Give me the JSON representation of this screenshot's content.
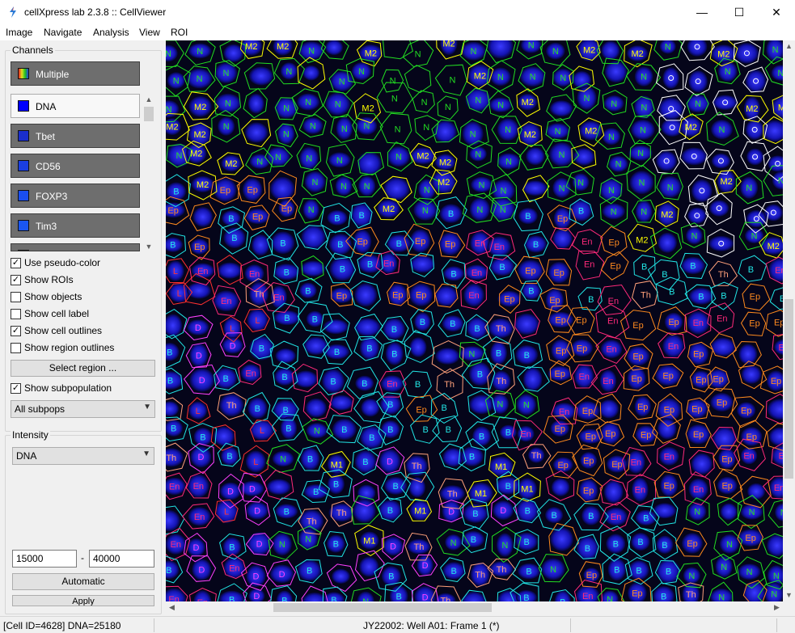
{
  "window": {
    "title": "cellXpress lab 2.3.8 :: CellViewer",
    "minimize": "—",
    "maximize": "☐",
    "close": "✕"
  },
  "menu": [
    "Image",
    "Navigate",
    "Analysis",
    "View",
    "ROI"
  ],
  "channels": {
    "label": "Channels",
    "items": [
      {
        "label": "Multiple",
        "color": "multi",
        "selected": false
      },
      {
        "label": "DNA",
        "color": "#0000ff",
        "selected": true
      },
      {
        "label": "Tbet",
        "color": "#0000ff",
        "selected": false
      },
      {
        "label": "CD56",
        "color": "#0000ff",
        "selected": false
      },
      {
        "label": "FOXP3",
        "color": "#0000ff",
        "selected": false
      },
      {
        "label": "Tim3",
        "color": "#0000ff",
        "selected": false
      }
    ]
  },
  "options": [
    {
      "label": "Use pseudo-color",
      "checked": true
    },
    {
      "label": "Show ROIs",
      "checked": true
    },
    {
      "label": "Show objects",
      "checked": false
    },
    {
      "label": "Show cell label",
      "checked": false
    },
    {
      "label": "Show cell outlines",
      "checked": true
    },
    {
      "label": "Show region outlines",
      "checked": false
    }
  ],
  "select_region_label": "Select region ...",
  "subpop": {
    "label": "Show subpopulation",
    "checked": true,
    "selected": "All subpops"
  },
  "intensity": {
    "label": "Intensity",
    "channel": "DNA",
    "min": "15000",
    "dash": "-",
    "max": "40000",
    "automatic_label": "Automatic",
    "apply_label": "Apply"
  },
  "status": {
    "cell": "[Cell ID=4628]  DNA=25180",
    "frame": "JY22002: Well A01: Frame 1 (*)"
  },
  "colors": {
    "N": "#22dd22",
    "M2": "#ffff00",
    "Ep": "#ff8a1e",
    "B": "#22e6e6",
    "En": "#ff2a7a",
    "Th": "#ffa07a",
    "L": "#ff3030",
    "D": "#ff40ff",
    "M1": "#ffff00",
    "Tc": "#ffa07a",
    "Tr": "#ffa07a",
    "O": "#ffffff"
  },
  "cell_labels": [
    "N",
    "M2",
    "Ep",
    "B",
    "En",
    "Th",
    "L",
    "D",
    "M1",
    "Tc",
    "Tr"
  ]
}
